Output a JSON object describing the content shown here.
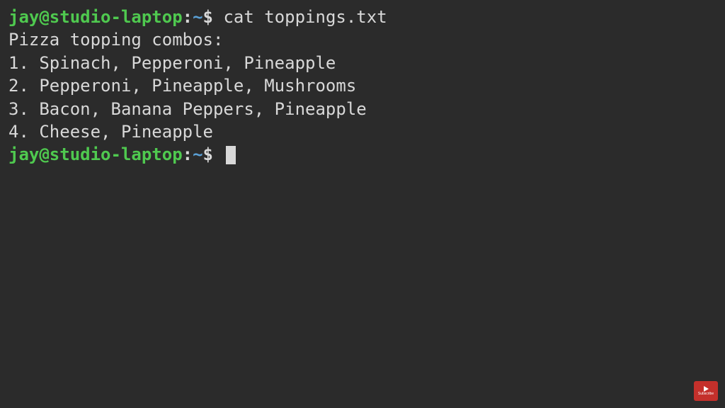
{
  "prompt": {
    "user_host": "jay@studio-laptop",
    "colon": ":",
    "path": "~",
    "dollar": "$"
  },
  "command": "cat toppings.txt",
  "output": {
    "header": "Pizza topping combos:",
    "lines": [
      "1. Spinach, Pepperoni, Pineapple",
      "2. Pepperoni, Pineapple, Mushrooms",
      "3. Bacon, Banana Peppers, Pineapple",
      "4. Cheese, Pineapple"
    ]
  },
  "badge": {
    "label": "Subscribe"
  }
}
